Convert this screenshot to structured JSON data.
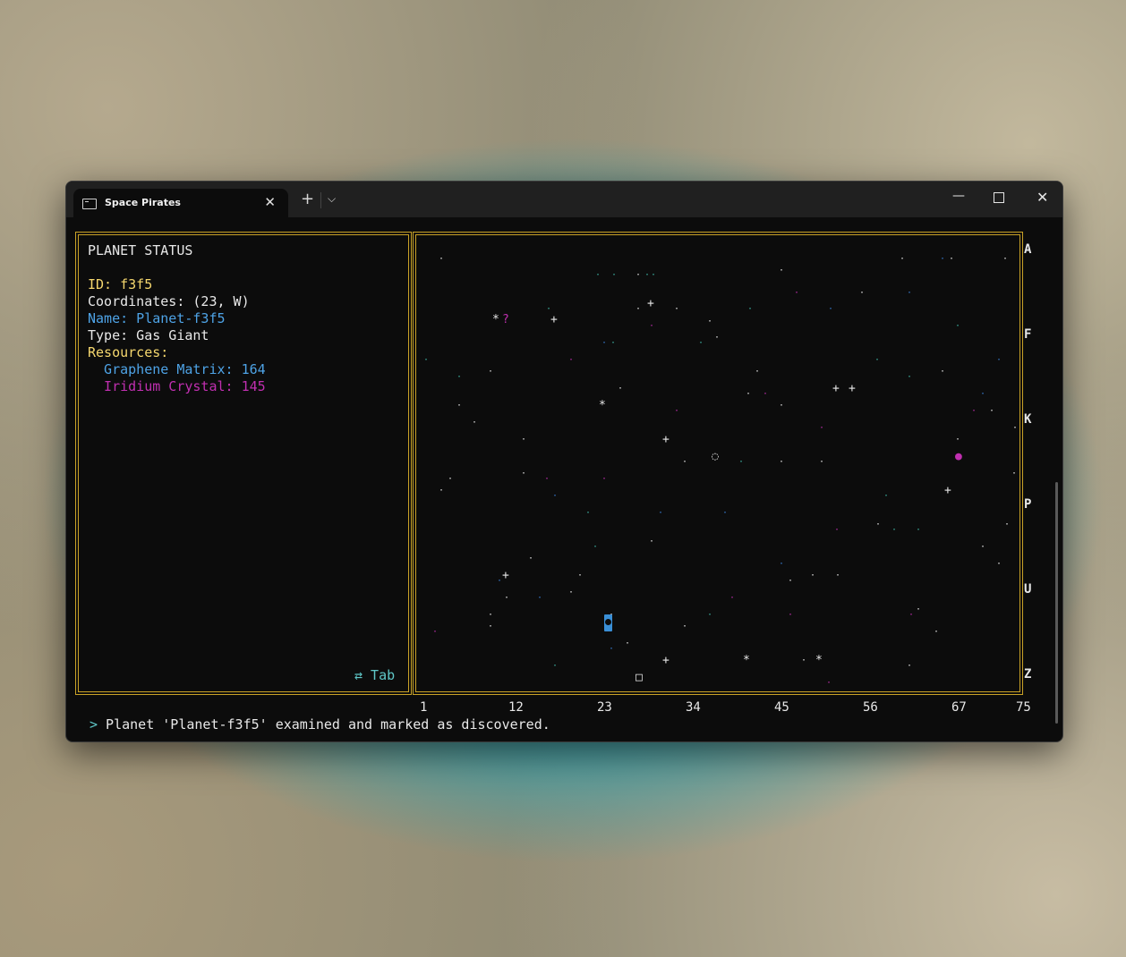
{
  "window": {
    "tab_title": "Space Pirates",
    "tab_icon": "terminal-icon",
    "close_tab_glyph": "✕",
    "new_tab_glyph": "+",
    "dropdown_glyph": "⌵",
    "minimize_glyph": "—",
    "close_glyph": "✕"
  },
  "status": {
    "heading": "PLANET STATUS",
    "id_line": "ID: f3f5",
    "coordinates_line": "Coordinates: (23, W)",
    "name_line": "Name: Planet-f3f5",
    "type_line": "Type: Gas Giant",
    "resources_label": "Resources:",
    "resources": [
      {
        "label": "  Graphene Matrix: 164",
        "color": "#4ea3e6"
      },
      {
        "label": "  Iridium Crystal: 145",
        "color": "#c02fb0"
      }
    ],
    "tab_hint": "⇄ Tab"
  },
  "map": {
    "row_labels": [
      "A",
      "F",
      "K",
      "P",
      "U",
      "Z"
    ],
    "col_labels": [
      "1",
      "12",
      "23",
      "34",
      "45",
      "56",
      "67",
      "75"
    ],
    "colors": {
      "star_white": "#e8e8e8",
      "teal": "#3fb8a8",
      "blue": "#3a7fd6",
      "magenta": "#c02fb0",
      "border": "#c9a227"
    }
  },
  "message": {
    "prompt": ">",
    "text": " Planet 'Planet-f3f5' examined and marked as discovered."
  }
}
